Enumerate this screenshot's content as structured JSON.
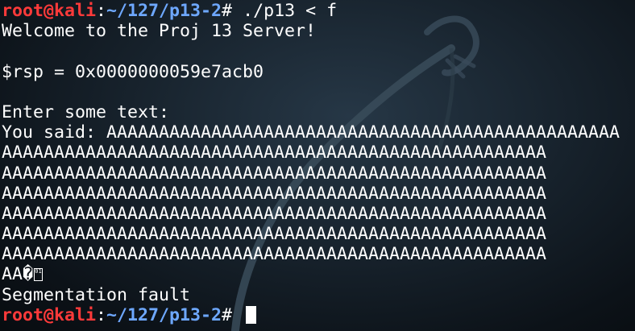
{
  "prompt": {
    "user_host": "root@kali",
    "separator": ":",
    "path": "~/127/p13-2",
    "symbol": "#"
  },
  "first_command": " ./p13 < f",
  "output": {
    "welcome": "Welcome to the Proj 13 Server!",
    "blank1": "",
    "rsp": "$rsp = 0x0000000059e7acb0",
    "blank2": "",
    "enter": "Enter some text:",
    "you_said_prefix": "You said: ",
    "you_said_first": "AAAAAAAAAAAAAAAAAAAAAAAAAAAAAAAAAAAAAAAAAAAAAAAAA",
    "a_lines": [
      "AAAAAAAAAAAAAAAAAAAAAAAAAAAAAAAAAAAAAAAAAAAAAAAAAAAA",
      "AAAAAAAAAAAAAAAAAAAAAAAAAAAAAAAAAAAAAAAAAAAAAAAAAAAA",
      "AAAAAAAAAAAAAAAAAAAAAAAAAAAAAAAAAAAAAAAAAAAAAAAAAAAA",
      "AAAAAAAAAAAAAAAAAAAAAAAAAAAAAAAAAAAAAAAAAAAAAAAAAAAA",
      "AAAAAAAAAAAAAAAAAAAAAAAAAAAAAAAAAAAAAAAAAAAAAAAAAAAA",
      "AAAAAAAAAAAAAAAAAAAAAAAAAAAAAAAAAAAAAAAAAAAAAAAAAAAA"
    ],
    "last_prefix": "AA",
    "replacement_char": "�",
    "box_char": "01",
    "segfault": "Segmentation fault"
  },
  "final_command": " ",
  "colors": {
    "prompt_user": "#ff3a3a",
    "prompt_path": "#6ea8ff",
    "text": "#ffffff",
    "background": "#17222c"
  }
}
